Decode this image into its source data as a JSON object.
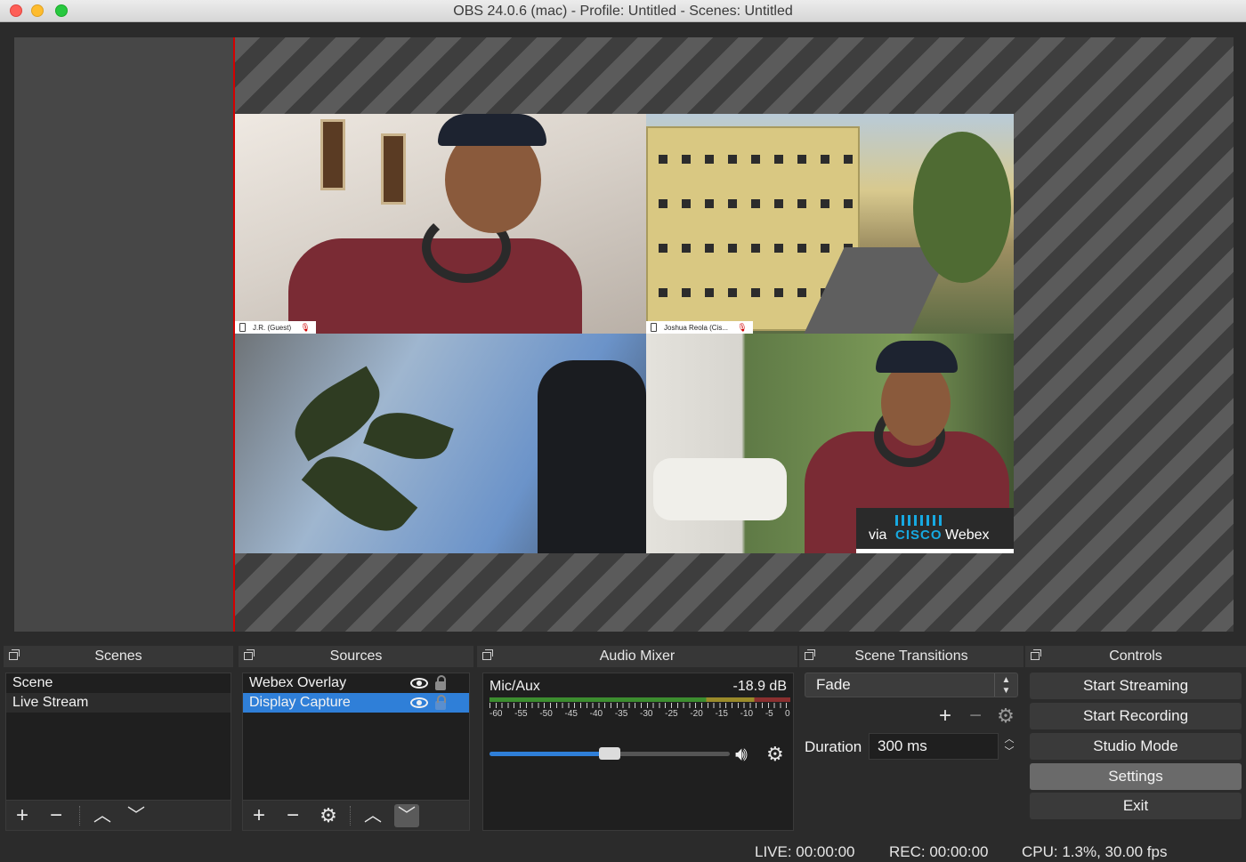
{
  "window": {
    "title": "OBS 24.0.6 (mac) - Profile: Untitled - Scenes: Untitled"
  },
  "preview": {
    "tiles": [
      {
        "name_tag": "J.R. (Guest)"
      },
      {
        "name_tag": "Joshua Reola (Cis..."
      },
      {
        "name_tag": ""
      },
      {
        "name_tag": ""
      }
    ],
    "webex_badge": {
      "via": "via",
      "brand": "CISCO",
      "product": "Webex"
    }
  },
  "scenes": {
    "title": "Scenes",
    "items": [
      "Scene",
      "Live Stream"
    ]
  },
  "sources": {
    "title": "Sources",
    "items": [
      "Webex Overlay",
      "Display Capture"
    ]
  },
  "audio_mixer": {
    "title": "Audio Mixer",
    "channel": "Mic/Aux",
    "level": "-18.9 dB",
    "meter_labels": [
      "-60",
      "-55",
      "-50",
      "-45",
      "-40",
      "-35",
      "-30",
      "-25",
      "-20",
      "-15",
      "-10",
      "-5",
      "0"
    ],
    "volume_fraction": 0.5
  },
  "transitions": {
    "title": "Scene Transitions",
    "selected": "Fade",
    "duration_label": "Duration",
    "duration_value": "300 ms"
  },
  "controls": {
    "title": "Controls",
    "start_streaming": "Start Streaming",
    "start_recording": "Start Recording",
    "studio_mode": "Studio Mode",
    "settings": "Settings",
    "exit": "Exit"
  },
  "status": {
    "live": "LIVE: 00:00:00",
    "rec": "REC: 00:00:00",
    "cpu": "CPU: 1.3%, 30.00 fps"
  },
  "colors": {
    "selection": "#2f7fd8",
    "canvas_border": "#d40000",
    "cisco_blue": "#17a9e1"
  }
}
